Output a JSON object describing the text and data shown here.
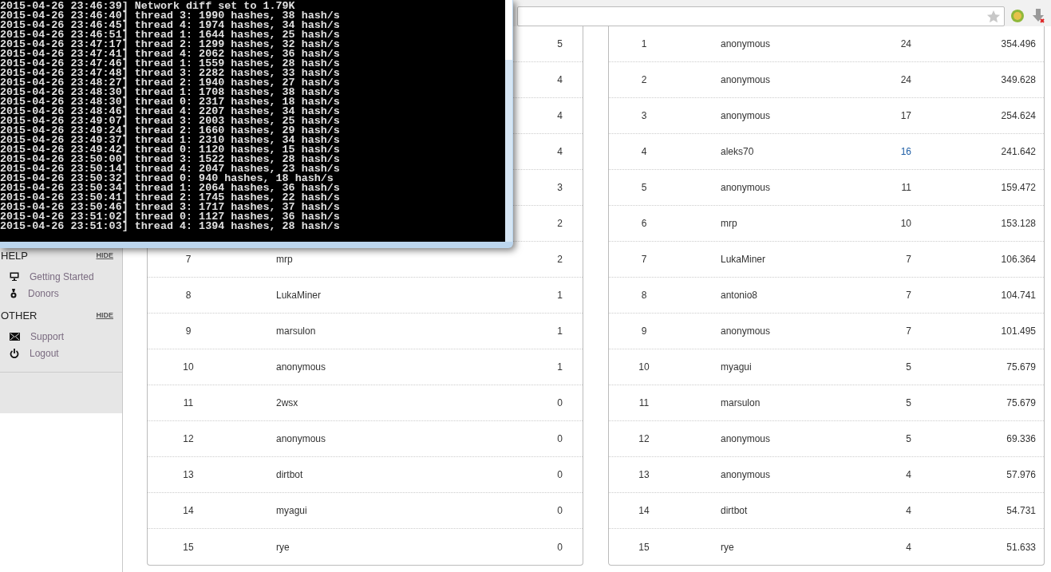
{
  "terminal": {
    "lines": [
      "2015-04-26 23:46:39] Network diff set to 1.79K",
      "2015-04-26 23:46:40] thread 3: 1990 hashes, 38 hash/s",
      "2015-04-26 23:46:45] thread 4: 1974 hashes, 34 hash/s",
      "2015-04-26 23:46:51] thread 1: 1644 hashes, 25 hash/s",
      "2015-04-26 23:47:17] thread 2: 1299 hashes, 32 hash/s",
      "2015-04-26 23:47:41] thread 4: 2062 hashes, 36 hash/s",
      "2015-04-26 23:47:46] thread 1: 1559 hashes, 28 hash/s",
      "2015-04-26 23:47:48] thread 3: 2282 hashes, 33 hash/s",
      "2015-04-26 23:48:27] thread 2: 1940 hashes, 27 hash/s",
      "2015-04-26 23:48:30] thread 1: 1708 hashes, 38 hash/s",
      "2015-04-26 23:48:30] thread 0: 2317 hashes, 18 hash/s",
      "2015-04-26 23:48:46] thread 4: 2207 hashes, 34 hash/s",
      "2015-04-26 23:49:07] thread 3: 2003 hashes, 25 hash/s",
      "2015-04-26 23:49:24] thread 2: 1660 hashes, 29 hash/s",
      "2015-04-26 23:49:37] thread 1: 2310 hashes, 34 hash/s",
      "2015-04-26 23:49:42] thread 0: 1120 hashes, 15 hash/s",
      "2015-04-26 23:50:00] thread 3: 1522 hashes, 28 hash/s",
      "2015-04-26 23:50:14] thread 4: 2047 hashes, 23 hash/s",
      "2015-04-26 23:50:32] thread 0: 940 hashes, 18 hash/s",
      "2015-04-26 23:50:34] thread 1: 2064 hashes, 36 hash/s",
      "2015-04-26 23:50:41] thread 2: 1745 hashes, 22 hash/s",
      "2015-04-26 23:50:46] thread 3: 1717 hashes, 37 hash/s",
      "2015-04-26 23:51:02] thread 0: 1127 hashes, 36 hash/s",
      "2015-04-26 23:51:03] thread 4: 1394 hashes, 28 hash/s"
    ]
  },
  "sidebar": {
    "sections": [
      {
        "title": "HELP",
        "toggle": "HIDE",
        "items": [
          {
            "label": "Getting Started"
          },
          {
            "label": "Donors"
          }
        ]
      },
      {
        "title": "OTHER",
        "toggle": "HIDE",
        "items": [
          {
            "label": "Support"
          },
          {
            "label": "Logout"
          }
        ]
      }
    ]
  },
  "left_table": {
    "rows": [
      {
        "count": "5"
      },
      {
        "count": "4"
      },
      {
        "count": "4"
      },
      {
        "count": "4"
      },
      {
        "count": "3"
      },
      {
        "count": "2"
      },
      {
        "rank": "7",
        "name": "mrp",
        "count": "2"
      },
      {
        "rank": "8",
        "name": "LukaMiner",
        "count": "1"
      },
      {
        "rank": "9",
        "name": "marsulon",
        "count": "1"
      },
      {
        "rank": "10",
        "name": "anonymous",
        "count": "1"
      },
      {
        "rank": "11",
        "name": "2wsx",
        "count": "0"
      },
      {
        "rank": "12",
        "name": "anonymous",
        "count": "0"
      },
      {
        "rank": "13",
        "name": "dirtbot",
        "count": "0"
      },
      {
        "rank": "14",
        "name": "myagui",
        "count": "0"
      },
      {
        "rank": "15",
        "name": "rye",
        "count": "0"
      }
    ]
  },
  "right_table": {
    "rows": [
      {
        "rank": "1",
        "name": "anonymous",
        "count": "24",
        "score": "354.496",
        "highlighted": false
      },
      {
        "rank": "2",
        "name": "anonymous",
        "count": "24",
        "score": "349.628",
        "highlighted": false
      },
      {
        "rank": "3",
        "name": "anonymous",
        "count": "17",
        "score": "254.624",
        "highlighted": false
      },
      {
        "rank": "4",
        "name": "aleks70",
        "count": "16",
        "score": "241.642",
        "highlighted": true
      },
      {
        "rank": "5",
        "name": "anonymous",
        "count": "11",
        "score": "159.472",
        "highlighted": false
      },
      {
        "rank": "6",
        "name": "mrp",
        "count": "10",
        "score": "153.128",
        "highlighted": false
      },
      {
        "rank": "7",
        "name": "LukaMiner",
        "count": "7",
        "score": "106.364",
        "highlighted": false
      },
      {
        "rank": "8",
        "name": "antonio8",
        "count": "7",
        "score": "104.741",
        "highlighted": false
      },
      {
        "rank": "9",
        "name": "anonymous",
        "count": "7",
        "score": "101.495",
        "highlighted": false
      },
      {
        "rank": "10",
        "name": "myagui",
        "count": "5",
        "score": "75.679",
        "highlighted": false
      },
      {
        "rank": "11",
        "name": "marsulon",
        "count": "5",
        "score": "75.679",
        "highlighted": false
      },
      {
        "rank": "12",
        "name": "anonymous",
        "count": "5",
        "score": "69.336",
        "highlighted": false
      },
      {
        "rank": "13",
        "name": "anonymous",
        "count": "4",
        "score": "57.976",
        "highlighted": false
      },
      {
        "rank": "14",
        "name": "dirtbot",
        "count": "4",
        "score": "54.731",
        "highlighted": false
      },
      {
        "rank": "15",
        "name": "rye",
        "count": "4",
        "score": "51.633",
        "highlighted": false
      }
    ]
  }
}
